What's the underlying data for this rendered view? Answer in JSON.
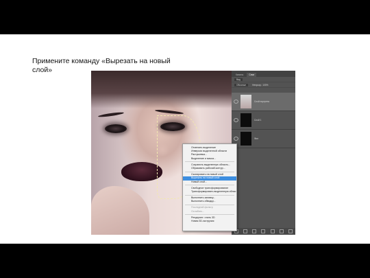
{
  "slide": {
    "caption": "Примените команду «Вырезать на новый слой»"
  },
  "photoshop": {
    "tabs": [
      "Каналы",
      "Слои"
    ],
    "active_tab": "Слои",
    "kind_filter": "Вид",
    "blend_mode": "Обычные",
    "opacity": "Непрозр.: 100%",
    "layers": [
      {
        "name": "Слой портрета",
        "thumb": "portrait"
      },
      {
        "name": "Слой 1",
        "thumb": "black"
      },
      {
        "name": "Фон",
        "thumb": "black"
      }
    ]
  },
  "context_menu": {
    "items": [
      {
        "label": "Отменить выделение",
        "state": "normal"
      },
      {
        "label": "Инверсия выделенной области",
        "state": "normal"
      },
      {
        "label": "Растушевка...",
        "state": "normal"
      },
      {
        "label": "Выделение и маска...",
        "state": "normal"
      },
      {
        "sep": true
      },
      {
        "label": "Сохранить выделенную область...",
        "state": "normal"
      },
      {
        "label": "Образовать рабочий контур...",
        "state": "normal"
      },
      {
        "sep": true
      },
      {
        "label": "Скопировать на новый слой",
        "state": "normal"
      },
      {
        "label": "Вырезать на новый слой",
        "state": "highlighted"
      },
      {
        "label": "Новый слой...",
        "state": "normal"
      },
      {
        "sep": true
      },
      {
        "label": "Свободное трансформирование",
        "state": "normal"
      },
      {
        "label": "Трансформировать выделенную область",
        "state": "normal"
      },
      {
        "sep": true
      },
      {
        "label": "Выполнить заливку...",
        "state": "normal"
      },
      {
        "label": "Выполнить обводку...",
        "state": "normal"
      },
      {
        "sep": true
      },
      {
        "label": "Последний фильтр",
        "state": "disabled"
      },
      {
        "label": "Ослабить...",
        "state": "disabled"
      },
      {
        "sep": true
      },
      {
        "label": "Рендеринг: стиль 3D",
        "state": "normal"
      },
      {
        "label": "Новая 3D-экструзия",
        "state": "normal"
      }
    ]
  }
}
